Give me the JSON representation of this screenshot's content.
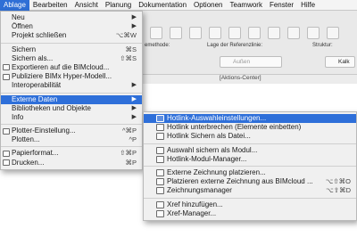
{
  "menubar": [
    "Ablage",
    "Bearbeiten",
    "Ansicht",
    "Planung",
    "Dokumentation",
    "Optionen",
    "Teamwork",
    "Fenster",
    "Hilfe"
  ],
  "toolbar": {
    "label_left": "emethode:",
    "label_mid": "Lage der Referenzlinie:",
    "label_right": "Struktur:",
    "field_mid": "Außen",
    "field_right": "Kalk",
    "tab": "[Aktions-Center]"
  },
  "ablage_menu": {
    "items": [
      {
        "label": "Neu",
        "arrow": "▶"
      },
      {
        "label": "Öffnen",
        "arrow": "▶"
      },
      {
        "label": "Projekt schließen",
        "shortcut": "⌥⌘W"
      },
      {
        "sep": true
      },
      {
        "label": "Sichern",
        "shortcut": "⌘S"
      },
      {
        "label": "Sichern als...",
        "shortcut": "⇧⌘S"
      },
      {
        "label": "Exportieren auf die BIMcloud...",
        "icon": true
      },
      {
        "label": "Publiziere BIMx Hyper-Modell...",
        "icon": true
      },
      {
        "label": "Interoperabilität",
        "arrow": "▶"
      },
      {
        "sep": true
      },
      {
        "label": "Externe Daten",
        "arrow": "▶",
        "highlighted": true
      },
      {
        "label": "Bibliotheken und Objekte",
        "arrow": "▶"
      },
      {
        "label": "Info",
        "arrow": "▶"
      },
      {
        "sep": true
      },
      {
        "label": "Plotter-Einstellung...",
        "shortcut": "^⌘P",
        "icon": true
      },
      {
        "label": "Plotten...",
        "shortcut": "^P"
      },
      {
        "sep": true
      },
      {
        "label": "Papierformat...",
        "shortcut": "⇧⌘P",
        "icon": true
      },
      {
        "label": "Drucken...",
        "shortcut": "⌘P",
        "icon": true
      }
    ]
  },
  "externe_daten_menu": {
    "items": [
      {
        "label": "Hotlink-Auswahleinstellungen...",
        "highlighted": true,
        "icon": true
      },
      {
        "label": "Hotlink unterbrechen (Elemente einbetten)",
        "icon": true
      },
      {
        "label": "Hotlink Sichern als Datei...",
        "icon": true
      },
      {
        "sep": true
      },
      {
        "label": "Auswahl sichern als Modul...",
        "icon": true
      },
      {
        "label": "Hotlink-Modul-Manager...",
        "icon": true
      },
      {
        "sep": true
      },
      {
        "label": "Externe Zeichnung platzieren...",
        "icon": true
      },
      {
        "label": "Platzieren externe Zeichnung aus BIMcloud ...",
        "shortcut": "⌥⇧⌘O",
        "icon": true
      },
      {
        "label": "Zeichnungsmanager",
        "shortcut": "⌥⇧⌘D",
        "icon": true
      },
      {
        "sep": true
      },
      {
        "label": "Xref hinzufügen...",
        "icon": true
      },
      {
        "label": "Xref-Manager...",
        "icon": true
      }
    ]
  }
}
